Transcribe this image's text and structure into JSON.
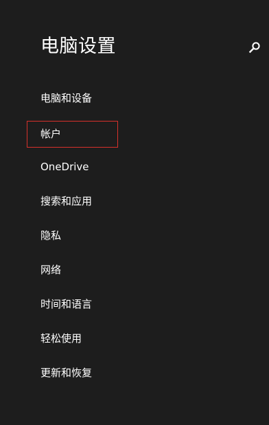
{
  "header": {
    "title": "电脑设置",
    "search_icon": "search-icon"
  },
  "nav": {
    "accent_color": "#d9312b",
    "items": [
      {
        "label": "电脑和设备"
      },
      {
        "label": "帐户",
        "selected": true
      },
      {
        "label": "OneDrive"
      },
      {
        "label": "搜索和应用"
      },
      {
        "label": "隐私"
      },
      {
        "label": "网络"
      },
      {
        "label": "时间和语言"
      },
      {
        "label": "轻松使用"
      },
      {
        "label": "更新和恢复"
      }
    ]
  }
}
